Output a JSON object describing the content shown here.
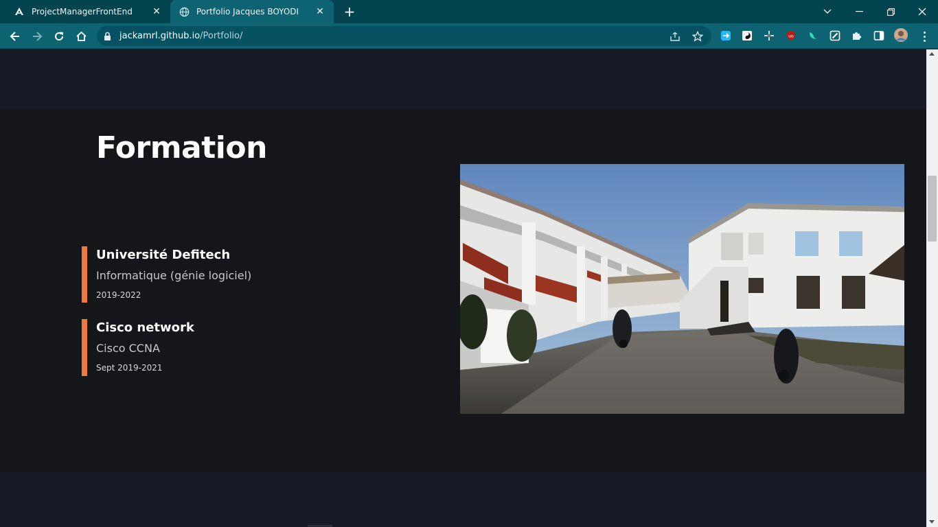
{
  "browser": {
    "tabs": [
      {
        "title": "ProjectManagerFrontEnd",
        "active": false,
        "favicon": "angular-icon"
      },
      {
        "title": "Portfolio Jacques BOYODI",
        "active": true,
        "favicon": "globe-icon"
      }
    ],
    "url": {
      "host": "jackamrl.github.io",
      "path": "/Portfolio/"
    },
    "theme_colors": {
      "tabstrip": "#03444f",
      "toolbar": "#0e6373",
      "omnibox": "#075262"
    },
    "extensions": [
      "translate-icon",
      "yinyang-icon",
      "crosshair-icon",
      "ublock-icon",
      "bird-icon",
      "note-icon",
      "puzzle-icon",
      "sidepanel-icon",
      "profile-avatar"
    ]
  },
  "formation": {
    "heading": "Formation",
    "accent_color": "#f07a3e",
    "items": [
      {
        "school": "Université Defitech",
        "program": "Informatique (génie logiciel)",
        "dates": "2019-2022"
      },
      {
        "school": "Cisco network",
        "program": "Cisco CCNA",
        "dates": "Sept 2019-2021"
      }
    ],
    "image_alt": "campus-building-photo"
  }
}
